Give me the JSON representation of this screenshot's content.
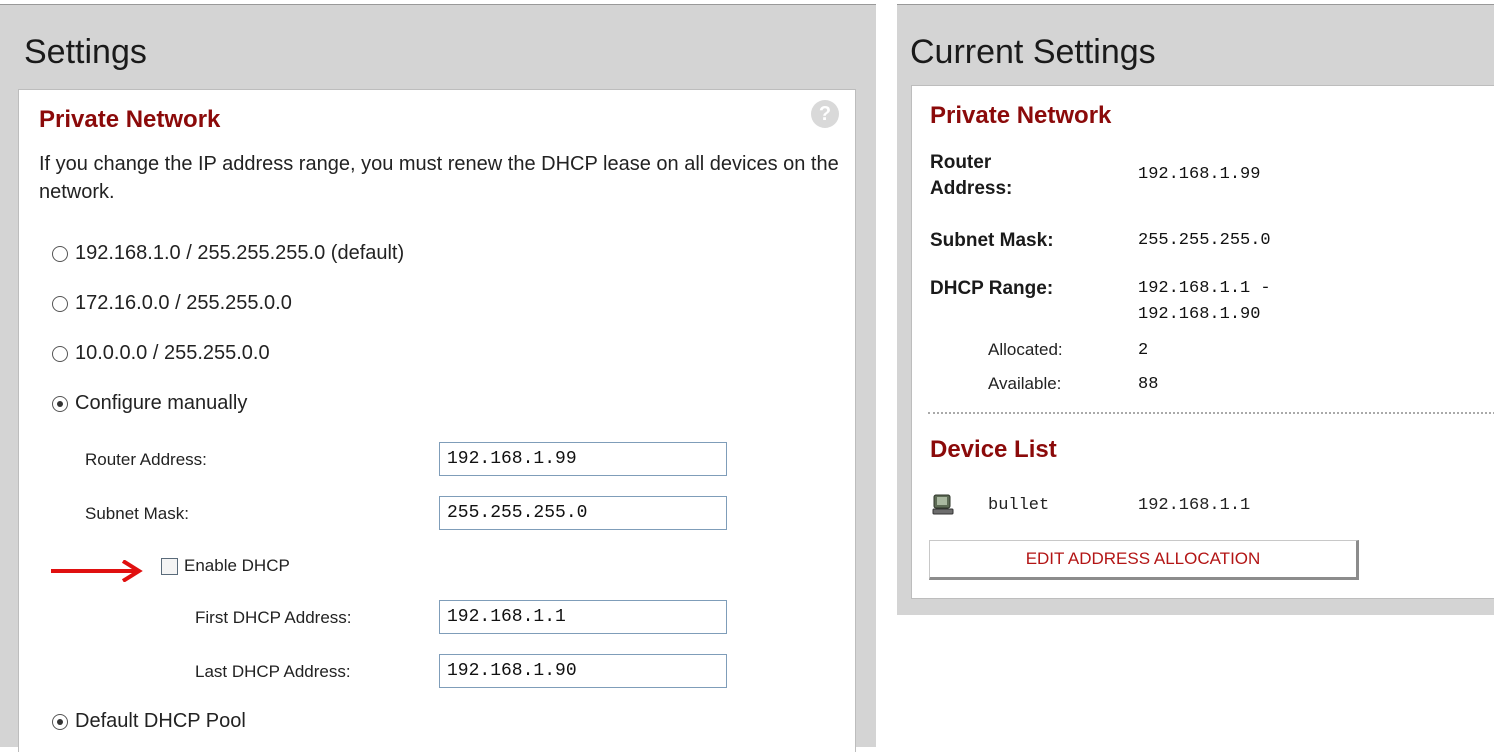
{
  "settings": {
    "title": "Settings",
    "section_title": "Private Network",
    "help_icon_glyph": "?",
    "description": "If you change the IP address range, you must renew the DHCP lease on all devices on the network.",
    "options": [
      {
        "label": "192.168.1.0 / 255.255.255.0 (default)",
        "checked": false
      },
      {
        "label": "172.16.0.0 / 255.255.0.0",
        "checked": false
      },
      {
        "label": "10.0.0.0 / 255.255.0.0",
        "checked": false
      },
      {
        "label": "Configure manually",
        "checked": true
      }
    ],
    "router_address_label": "Router Address:",
    "router_address_value": "192.168.1.99",
    "subnet_mask_label": "Subnet Mask:",
    "subnet_mask_value": "255.255.255.0",
    "enable_dhcp_label": "Enable DHCP",
    "enable_dhcp_checked": false,
    "first_dhcp_label": "First DHCP Address:",
    "first_dhcp_value": "192.168.1.1",
    "last_dhcp_label": "Last DHCP Address:",
    "last_dhcp_value": "192.168.1.90",
    "default_pool_label": "Default DHCP Pool",
    "default_pool_checked": true,
    "arrow_color": "#e01010"
  },
  "current": {
    "title": "Current Settings",
    "section_title": "Private Network",
    "router_label_line1": "Router",
    "router_label_line2": "Address:",
    "router_value": "192.168.1.99",
    "subnet_label": "Subnet Mask:",
    "subnet_value": "255.255.255.0",
    "dhcp_range_label": "DHCP Range:",
    "dhcp_range_line1": "192.168.1.1 -",
    "dhcp_range_line2": "192.168.1.90",
    "allocated_label": "Allocated:",
    "allocated_value": "2",
    "available_label": "Available:",
    "available_value": "88",
    "device_list_title": "Device List",
    "devices": [
      {
        "name": "bullet",
        "ip": "192.168.1.1",
        "icon": "computer-icon"
      }
    ],
    "edit_button_label": "EDIT ADDRESS ALLOCATION"
  },
  "colors": {
    "section_title": "#8b0a0a",
    "panel_bg": "#d4d4d4",
    "edit_button_text": "#b31515"
  }
}
